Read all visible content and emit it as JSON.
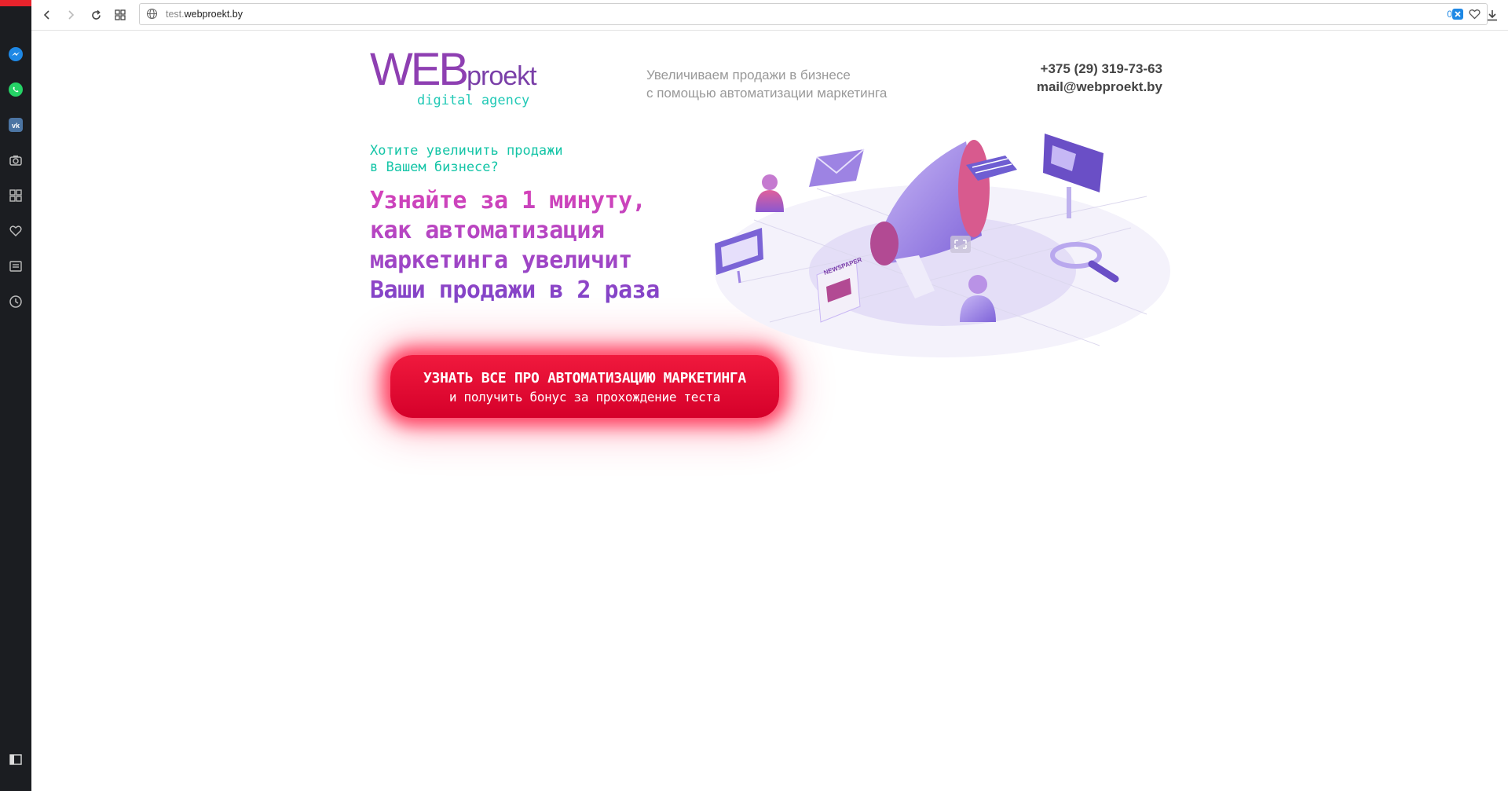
{
  "browser": {
    "url_sub": "test.",
    "url_domain": "webproekt.by",
    "tracker_count": "0"
  },
  "sidebar": {
    "items": [
      "messenger-icon",
      "whatsapp-icon",
      "vk-icon",
      "camera-icon",
      "grid-icon",
      "heart-icon",
      "news-icon",
      "history-icon"
    ]
  },
  "header": {
    "logo_web": "WEB",
    "logo_proekt": "proekt",
    "logo_agency": "digital agency",
    "tagline_1": "Увеличиваем продажи в бизнесе",
    "tagline_2": "с помощью автоматизации маркетинга",
    "phone": "+375 (29) 319-73-63",
    "email": "mail@webproekt.by"
  },
  "hero": {
    "question_1": "Хотите увеличить продажи",
    "question_2": "в Вашем бизнесе?",
    "headline_1": "Узнайте за 1 минуту,",
    "headline_2": "как автоматизация",
    "headline_3": "маркетинга увеличит",
    "headline_4": "Ваши продажи в 2 раза",
    "cta_line1": "УЗНАТЬ ВСЕ ПРО АВТОМАТИЗАЦИЮ МАРКЕТИНГА",
    "cta_line2": "и получить бонус за прохождение теста",
    "illustration_label": "NEWSPAPER"
  },
  "colors": {
    "accent_red": "#e8232c",
    "logo_purple": "#8e3fb2",
    "agency_teal": "#22c9b6",
    "cta_red": "#e8102f"
  }
}
